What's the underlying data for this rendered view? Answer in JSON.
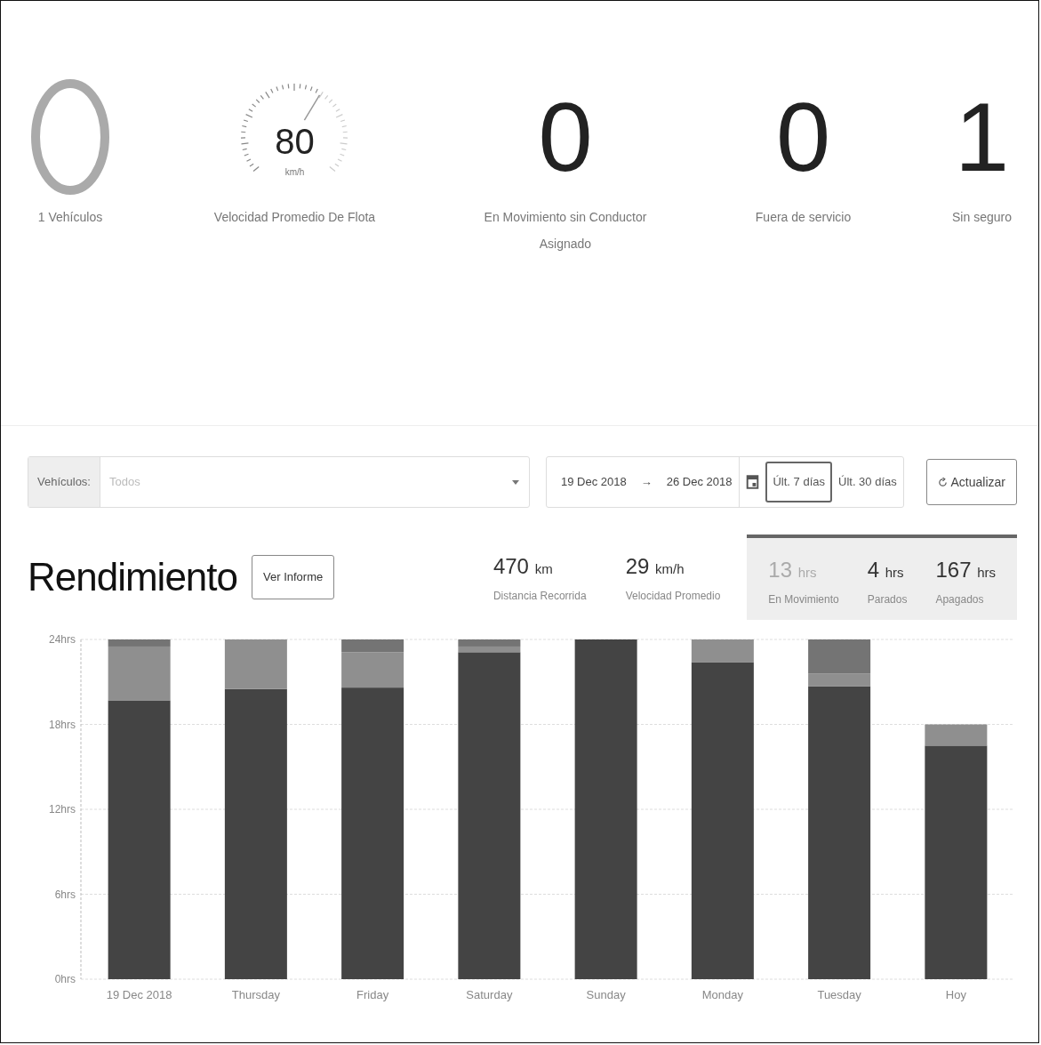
{
  "stats": [
    {
      "kind": "ring",
      "label": "1 Vehículos"
    },
    {
      "kind": "gauge",
      "value": "80",
      "unit": "km/h",
      "label": "Velocidad Promedio De Flota"
    },
    {
      "kind": "number",
      "value": "0",
      "label": "En Movimiento sin Conductor Asignado"
    },
    {
      "kind": "number",
      "value": "0",
      "label": "Fuera de servicio"
    },
    {
      "kind": "number",
      "value": "1",
      "label": "Sin seguro"
    }
  ],
  "filters": {
    "vehicle_label": "Vehículos:",
    "vehicle_placeholder": "Todos",
    "date_from": "19 Dec 2018",
    "arrow": "→",
    "date_to": "26 Dec 2018",
    "ranges": [
      {
        "label": "Últ. 7 días",
        "selected": true
      },
      {
        "label": "Últ. 30 días",
        "selected": false
      }
    ],
    "refresh": "Actualizar"
  },
  "performance": {
    "title": "Rendimiento",
    "report_button": "Ver Informe",
    "metrics": [
      {
        "value": "470",
        "unit": "km",
        "label": "Distancia Recorrida"
      },
      {
        "value": "29",
        "unit": "km/h",
        "label": "Velocidad Promedio"
      }
    ],
    "hours": [
      {
        "value": "13",
        "unit": "hrs",
        "label": "En Movimiento",
        "muted": true
      },
      {
        "value": "4",
        "unit": "hrs",
        "label": "Parados",
        "muted": false
      },
      {
        "value": "167",
        "unit": "hrs",
        "label": "Apagados",
        "muted": false
      }
    ],
    "chart_data": {
      "type": "bar",
      "stacked": true,
      "grid": true,
      "categories": [
        "19 Dec 2018",
        "Thursday",
        "Friday",
        "Saturday",
        "Sunday",
        "Monday",
        "Tuesday",
        "Hoy"
      ],
      "series": [
        {
          "color": "#444444",
          "values": [
            19.7,
            20.5,
            20.6,
            23.1,
            24,
            22.4,
            20.7,
            16.5
          ]
        },
        {
          "color": "#8f8f8f",
          "values": [
            3.8,
            3.5,
            2.5,
            0.4,
            0,
            1.6,
            0.9,
            1.5
          ]
        },
        {
          "color": "#747474",
          "values": [
            0.5,
            0,
            0.9,
            0.5,
            0,
            0,
            2.4,
            0
          ]
        }
      ],
      "ylim": [
        0,
        24
      ],
      "yticks": [
        {
          "value": 0,
          "label": "0hrs"
        },
        {
          "value": 6,
          "label": "6hrs"
        },
        {
          "value": 12,
          "label": "12hrs"
        },
        {
          "value": 18,
          "label": "18hrs"
        },
        {
          "value": 24,
          "label": "24hrs"
        }
      ]
    }
  }
}
